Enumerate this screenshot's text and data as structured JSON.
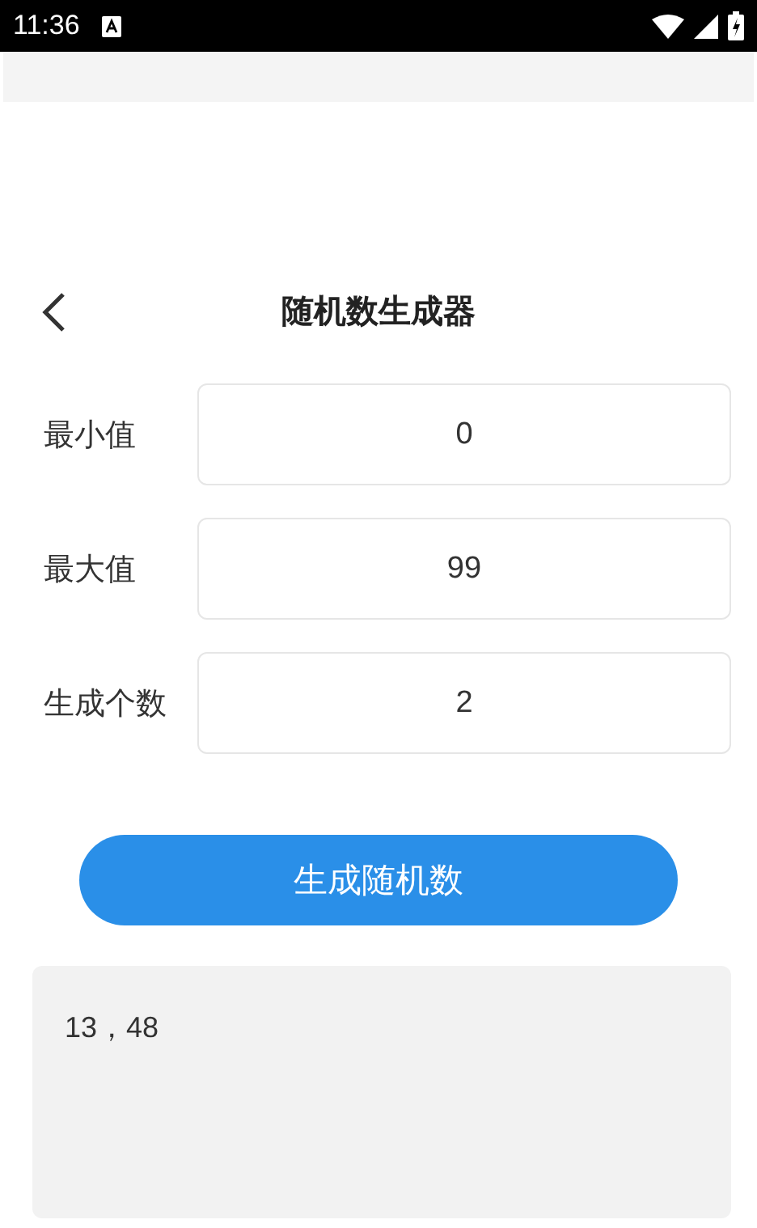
{
  "status_bar": {
    "time": "11:36"
  },
  "header": {
    "title": "随机数生成器"
  },
  "fields": [
    {
      "label": "最小值",
      "value": "0"
    },
    {
      "label": "最大值",
      "value": "99"
    },
    {
      "label": "生成个数",
      "value": "2"
    }
  ],
  "generate_button": {
    "label": "生成随机数"
  },
  "result": {
    "text": "13，48"
  }
}
